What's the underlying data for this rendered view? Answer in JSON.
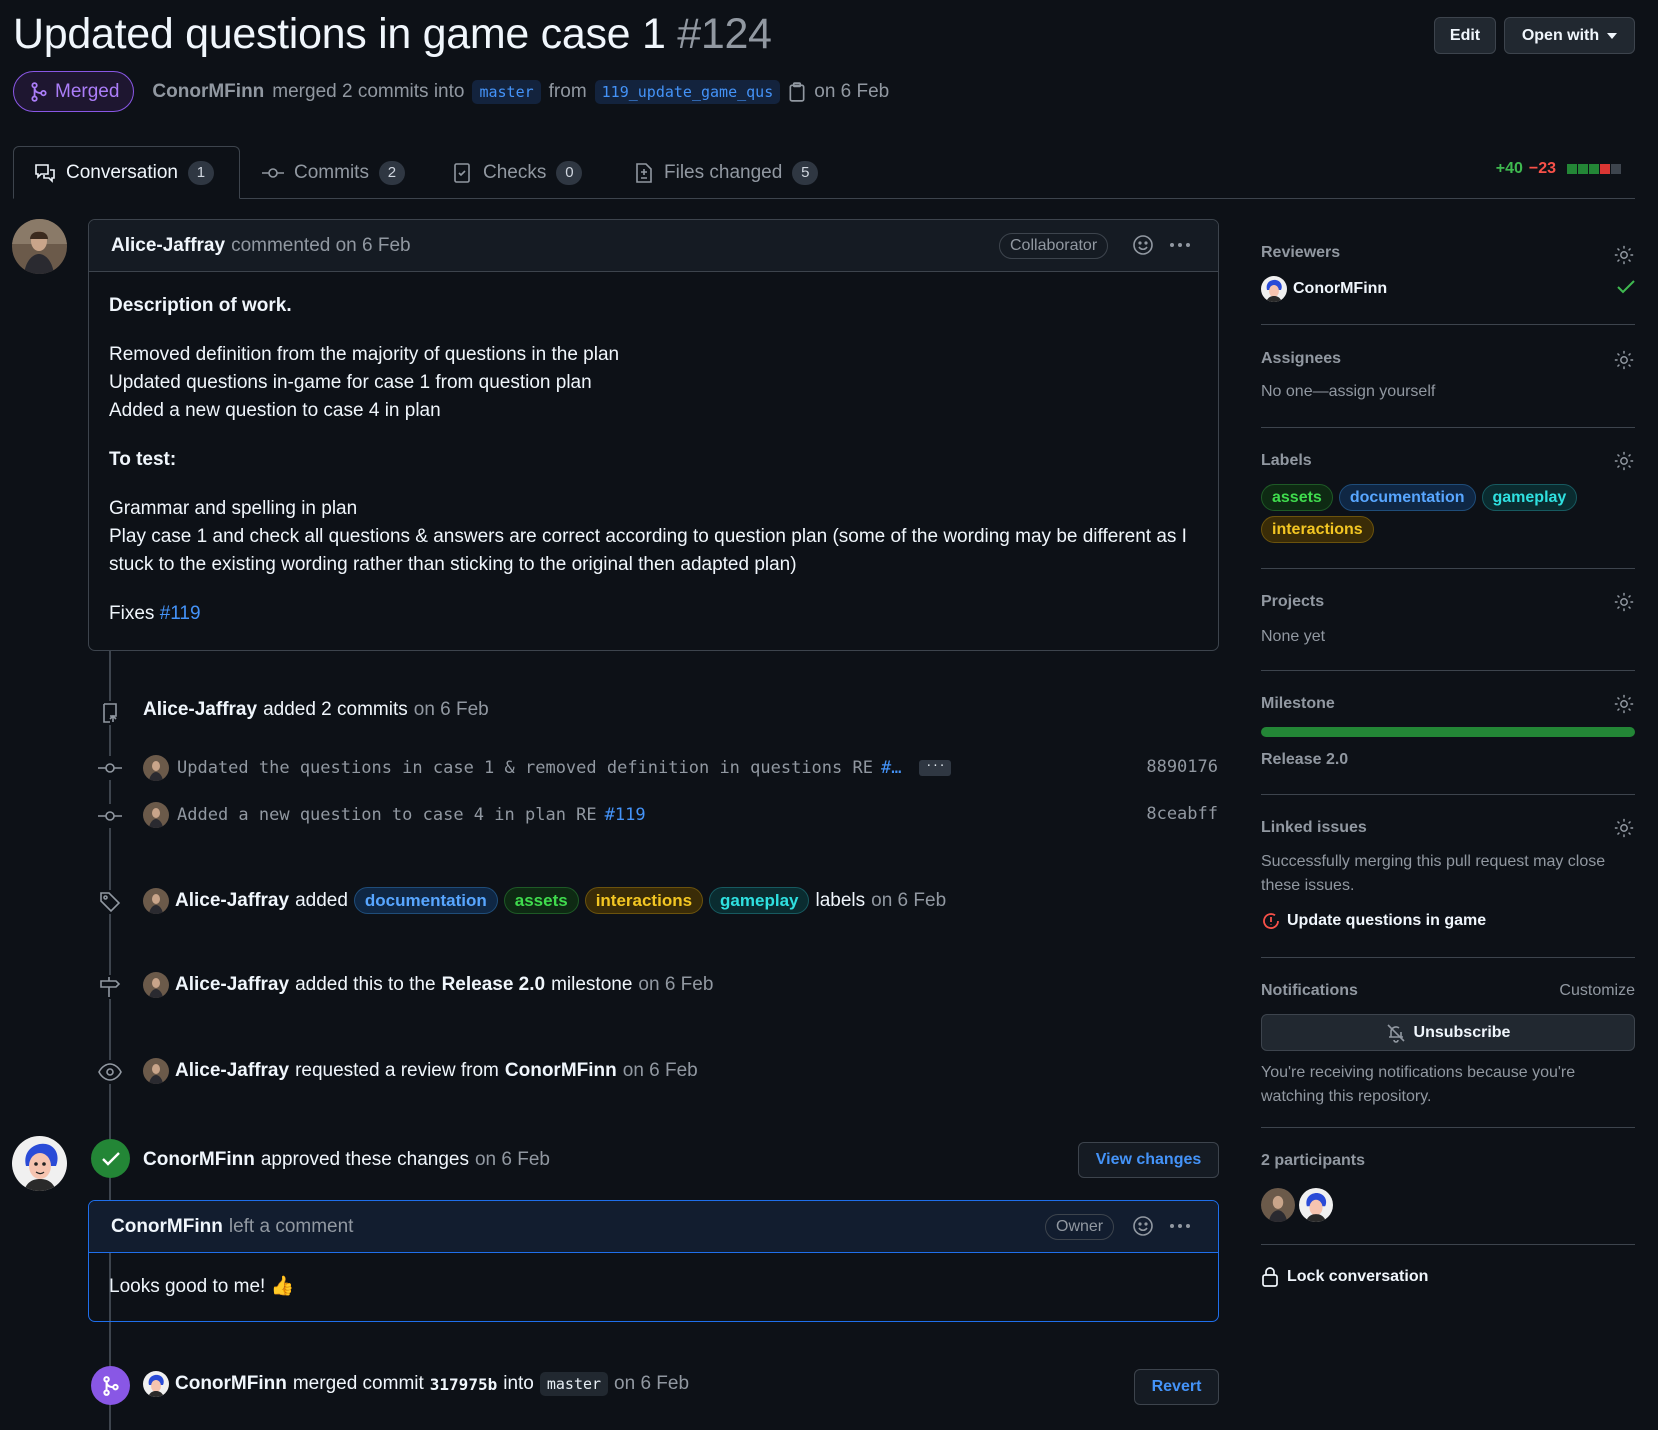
{
  "header": {
    "title": "Updated questions in game case 1",
    "number": "#124",
    "edit_label": "Edit",
    "open_with_label": "Open with",
    "state": "Merged",
    "author": "ConorMFinn",
    "merge_text": "merged 2 commits into",
    "base_branch": "master",
    "from_text": "from",
    "head_branch": "119_update_game_qus",
    "date_text": "on 6 Feb"
  },
  "tabs": [
    {
      "label": "Conversation",
      "count": "1"
    },
    {
      "label": "Commits",
      "count": "2"
    },
    {
      "label": "Checks",
      "count": "0"
    },
    {
      "label": "Files changed",
      "count": "5"
    }
  ],
  "diffstat": {
    "additions": "+40",
    "deletions": "−23"
  },
  "opening_comment": {
    "author": "Alice-Jaffray",
    "action": "commented on 6 Feb",
    "role": "Collaborator",
    "heading1": "Description of work.",
    "lines1": [
      "Removed definition from the majority of questions in the plan",
      "Updated questions in-game for case 1 from question plan",
      "Added a new question to case 4 in plan"
    ],
    "heading2": "To test:",
    "lines2": [
      "Grammar and spelling in plan",
      "Play case 1 and check all questions & answers are correct according to question plan (some of the wording may be different as I stuck to the existing wording rather than sticking to the original then adapted plan)"
    ],
    "fixes_text": "Fixes",
    "fixes_link": "#119"
  },
  "timeline": {
    "commits_event": {
      "who": "Alice-Jaffray",
      "text": "added 2 commits",
      "date": "on 6 Feb"
    },
    "commits": [
      {
        "message": "Updated the questions in case 1 & removed definition in questions RE",
        "link": "#…",
        "sha": "8890176"
      },
      {
        "message": "Added a new question to case 4 in plan RE",
        "link": "#119",
        "sha": "8ceabff"
      }
    ],
    "labels_event": {
      "who": "Alice-Jaffray",
      "text": "added",
      "suffix": "labels",
      "date": "on 6 Feb"
    },
    "milestone_event": {
      "who": "Alice-Jaffray",
      "text": "added this to the",
      "milestone": "Release 2.0",
      "suffix": "milestone",
      "date": "on 6 Feb"
    },
    "review_request_event": {
      "who": "Alice-Jaffray",
      "text": "requested a review from",
      "reviewer": "ConorMFinn",
      "date": "on 6 Feb"
    },
    "approval_event": {
      "who": "ConorMFinn",
      "text": "approved these changes",
      "date": "on 6 Feb",
      "button": "View changes"
    },
    "review_comment": {
      "author": "ConorMFinn",
      "action": "left a comment",
      "role": "Owner",
      "body": "Looks good to me! 👍"
    },
    "merge_event": {
      "who": "ConorMFinn",
      "text": "merged commit",
      "sha": "317975b",
      "into": "into",
      "branch": "master",
      "date": "on 6 Feb",
      "button": "Revert"
    }
  },
  "labels": [
    {
      "name": "documentation",
      "color": "#58a6ff"
    },
    {
      "name": "assets",
      "color": "#3fdb4d"
    },
    {
      "name": "interactions",
      "color": "#f3c623"
    },
    {
      "name": "gameplay",
      "color": "#2fe0e0"
    }
  ],
  "sidebar": {
    "reviewers": {
      "title": "Reviewers",
      "name": "ConorMFinn"
    },
    "assignees": {
      "title": "Assignees",
      "text": "No one—assign yourself"
    },
    "labels": {
      "title": "Labels",
      "items": [
        "assets",
        "documentation",
        "gameplay",
        "interactions"
      ]
    },
    "projects": {
      "title": "Projects",
      "text": "None yet"
    },
    "milestone": {
      "title": "Milestone",
      "name": "Release 2.0",
      "progress": 1.0
    },
    "linked_issues": {
      "title": "Linked issues",
      "text": "Successfully merging this pull request may close these issues.",
      "issue": "Update questions in game"
    },
    "notifications": {
      "title": "Notifications",
      "customize": "Customize",
      "button": "Unsubscribe",
      "text": "You're receiving notifications because you're watching this repository."
    },
    "participants": {
      "title": "2 participants"
    },
    "lock": {
      "label": "Lock conversation"
    }
  },
  "colors": {
    "merged": "#8957e5",
    "approved": "#238636",
    "link": "#4493f8",
    "background": "#0d1117"
  }
}
